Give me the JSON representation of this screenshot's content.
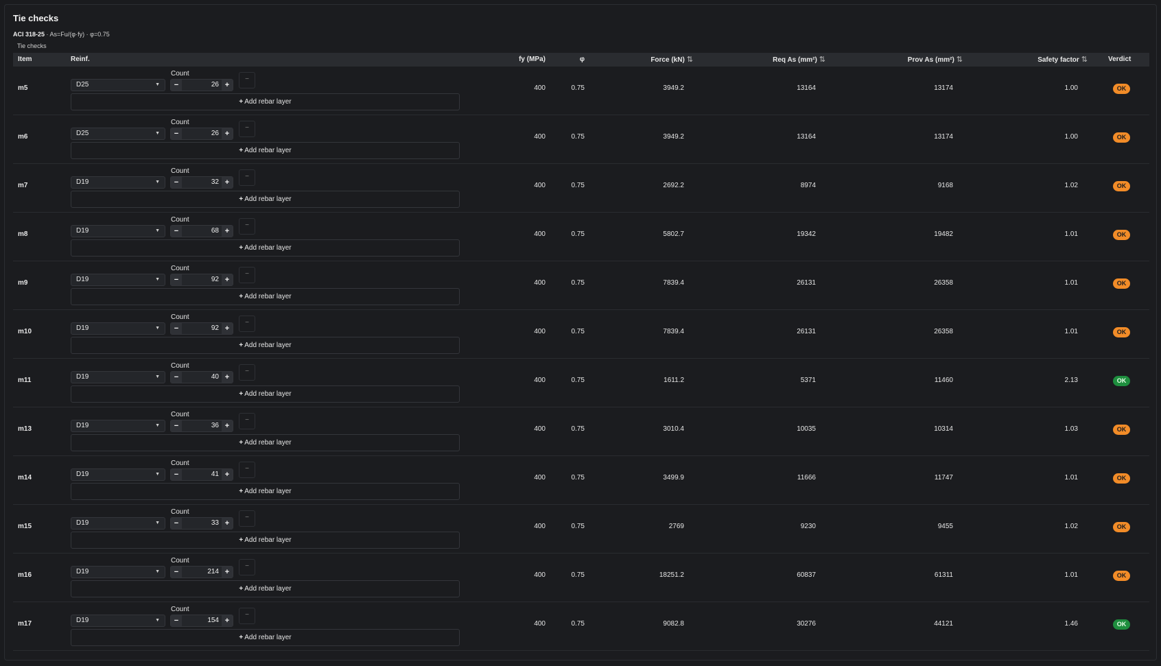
{
  "panel": {
    "title": "Tie checks",
    "code": "ACI 318-25",
    "formula": " · As=Fu/(φ·fy) · φ=0.75",
    "caption": "Tie checks"
  },
  "columns": {
    "item": "Item",
    "reinf": "Reinf.",
    "fy": "fy (MPa)",
    "phi": "φ",
    "force": "Force (kN)",
    "req_as": "Req As (mm²)",
    "prov_as": "Prov As (mm²)",
    "safety": "Safety factor",
    "verdict": "Verdict"
  },
  "labels": {
    "count": "Count",
    "add_layer": "Add rebar layer",
    "minus": "−",
    "plus": "+",
    "remove": "−",
    "caret": "▼"
  },
  "colors": {
    "ok_orange": "#f28c28",
    "ok_green": "#1e8e3e"
  },
  "rows": [
    {
      "item": "m5",
      "bar": "D25",
      "count": "26",
      "fy": "400",
      "phi": "0.75",
      "force": "3949.2",
      "req": "13164",
      "prov": "13174",
      "sf": "1.00",
      "verdict": "OK",
      "status": "orange"
    },
    {
      "item": "m6",
      "bar": "D25",
      "count": "26",
      "fy": "400",
      "phi": "0.75",
      "force": "3949.2",
      "req": "13164",
      "prov": "13174",
      "sf": "1.00",
      "verdict": "OK",
      "status": "orange"
    },
    {
      "item": "m7",
      "bar": "D19",
      "count": "32",
      "fy": "400",
      "phi": "0.75",
      "force": "2692.2",
      "req": "8974",
      "prov": "9168",
      "sf": "1.02",
      "verdict": "OK",
      "status": "orange"
    },
    {
      "item": "m8",
      "bar": "D19",
      "count": "68",
      "fy": "400",
      "phi": "0.75",
      "force": "5802.7",
      "req": "19342",
      "prov": "19482",
      "sf": "1.01",
      "verdict": "OK",
      "status": "orange"
    },
    {
      "item": "m9",
      "bar": "D19",
      "count": "92",
      "fy": "400",
      "phi": "0.75",
      "force": "7839.4",
      "req": "26131",
      "prov": "26358",
      "sf": "1.01",
      "verdict": "OK",
      "status": "orange"
    },
    {
      "item": "m10",
      "bar": "D19",
      "count": "92",
      "fy": "400",
      "phi": "0.75",
      "force": "7839.4",
      "req": "26131",
      "prov": "26358",
      "sf": "1.01",
      "verdict": "OK",
      "status": "orange"
    },
    {
      "item": "m11",
      "bar": "D19",
      "count": "40",
      "fy": "400",
      "phi": "0.75",
      "force": "1611.2",
      "req": "5371",
      "prov": "11460",
      "sf": "2.13",
      "verdict": "OK",
      "status": "green"
    },
    {
      "item": "m13",
      "bar": "D19",
      "count": "36",
      "fy": "400",
      "phi": "0.75",
      "force": "3010.4",
      "req": "10035",
      "prov": "10314",
      "sf": "1.03",
      "verdict": "OK",
      "status": "orange"
    },
    {
      "item": "m14",
      "bar": "D19",
      "count": "41",
      "fy": "400",
      "phi": "0.75",
      "force": "3499.9",
      "req": "11666",
      "prov": "11747",
      "sf": "1.01",
      "verdict": "OK",
      "status": "orange"
    },
    {
      "item": "m15",
      "bar": "D19",
      "count": "33",
      "fy": "400",
      "phi": "0.75",
      "force": "2769",
      "req": "9230",
      "prov": "9455",
      "sf": "1.02",
      "verdict": "OK",
      "status": "orange"
    },
    {
      "item": "m16",
      "bar": "D19",
      "count": "214",
      "fy": "400",
      "phi": "0.75",
      "force": "18251.2",
      "req": "60837",
      "prov": "61311",
      "sf": "1.01",
      "verdict": "OK",
      "status": "orange"
    },
    {
      "item": "m17",
      "bar": "D19",
      "count": "154",
      "fy": "400",
      "phi": "0.75",
      "force": "9082.8",
      "req": "30276",
      "prov": "44121",
      "sf": "1.46",
      "verdict": "OK",
      "status": "green"
    }
  ]
}
